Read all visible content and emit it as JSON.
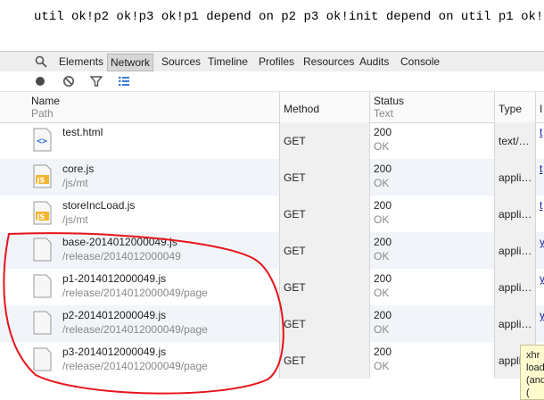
{
  "page_output": {
    "text": "util ok!p2 ok!p3 ok!p1 depend on p2 p3 ok!init depend on util p1 ok!"
  },
  "tabs": [
    {
      "label": "Elements"
    },
    {
      "label": "Network",
      "active": true
    },
    {
      "label": "Sources"
    },
    {
      "label": "Timeline"
    },
    {
      "label": "Profiles"
    },
    {
      "label": "Resources"
    },
    {
      "label": "Audits"
    },
    {
      "label": "Console"
    }
  ],
  "toolbar": {
    "icons": [
      "record-icon",
      "clear-icon",
      "filter-icon",
      "list-view-icon"
    ]
  },
  "columns": {
    "name_title": "Name",
    "name_sub": "Path",
    "method": "Method",
    "status_title": "Status",
    "status_sub": "Text",
    "type": "Type",
    "initiator": "I"
  },
  "rows": [
    {
      "name": "test.html",
      "path": "",
      "method": "GET",
      "status": "200",
      "text": "OK",
      "type": "text/…",
      "icon": "html-file-icon",
      "initiator": "t"
    },
    {
      "name": "core.js",
      "path": "/js/mt",
      "method": "GET",
      "status": "200",
      "text": "OK",
      "type": "appli…",
      "icon": "js-file-icon",
      "initiator": "t"
    },
    {
      "name": "storeIncLoad.js",
      "path": "/js/mt",
      "method": "GET",
      "status": "200",
      "text": "OK",
      "type": "appli…",
      "icon": "js-file-icon",
      "initiator": "t"
    },
    {
      "name": "base-2014012000049.js",
      "path": "/release/2014012000049",
      "method": "GET",
      "status": "200",
      "text": "OK",
      "type": "appli…",
      "icon": "blank-file-icon",
      "initiator": "y"
    },
    {
      "name": "p1-2014012000049.js",
      "path": "/release/2014012000049/page",
      "method": "GET",
      "status": "200",
      "text": "OK",
      "type": "appli…",
      "icon": "blank-file-icon",
      "initiator": "y"
    },
    {
      "name": "p2-2014012000049.js",
      "path": "/release/2014012000049/page",
      "method": "GET",
      "status": "200",
      "text": "OK",
      "type": "appli…",
      "icon": "blank-file-icon",
      "initiator": "y"
    },
    {
      "name": "p3-2014012000049.js",
      "path": "/release/2014012000049/page",
      "method": "GET",
      "status": "200",
      "text": "OK",
      "type": "appli",
      "icon": "blank-file-icon",
      "initiator": ""
    }
  ],
  "tooltip": {
    "line1": "xhr",
    "line2": "load",
    "line3": "(and",
    "line4": "("
  },
  "colors": {
    "annotation": "#e8141b",
    "selected_tab_bg": "#d7d7d7"
  }
}
